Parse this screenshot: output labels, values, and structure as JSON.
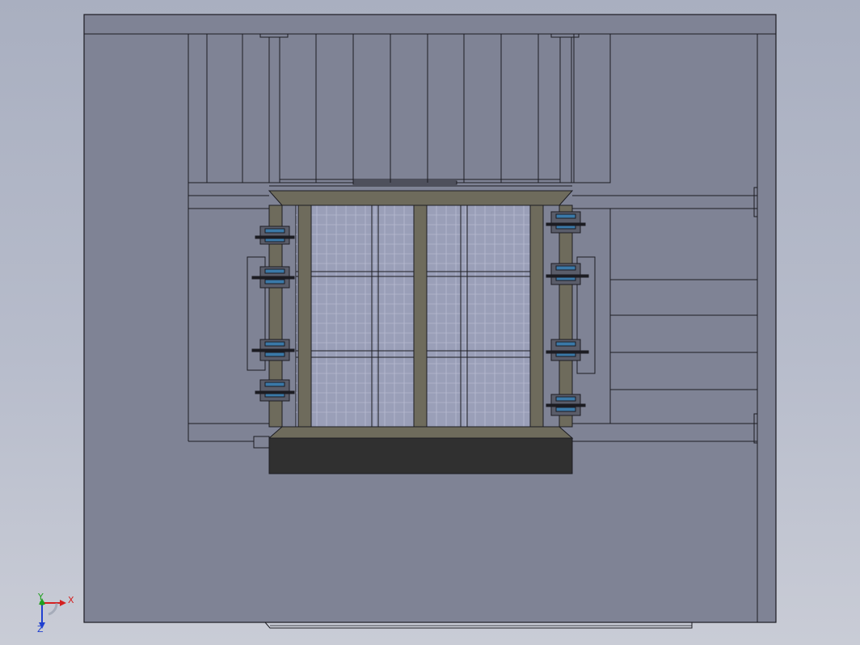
{
  "viewport": {
    "background_top": "#a9afc0",
    "background_bottom": "#c9ccd6",
    "model_fill": "#7f8395",
    "line_color": "#1c1c22",
    "frame_fill": "#6e6b5c",
    "dark_fill": "#303030",
    "mesh_fill": "#9a9fb8",
    "bearing_color": "#3a79a8"
  },
  "triad": {
    "x_label": "X",
    "y_label": "Y",
    "z_label": "Z",
    "x_color": "#d42020",
    "y_color": "#20a020",
    "z_color": "#2040d0"
  }
}
